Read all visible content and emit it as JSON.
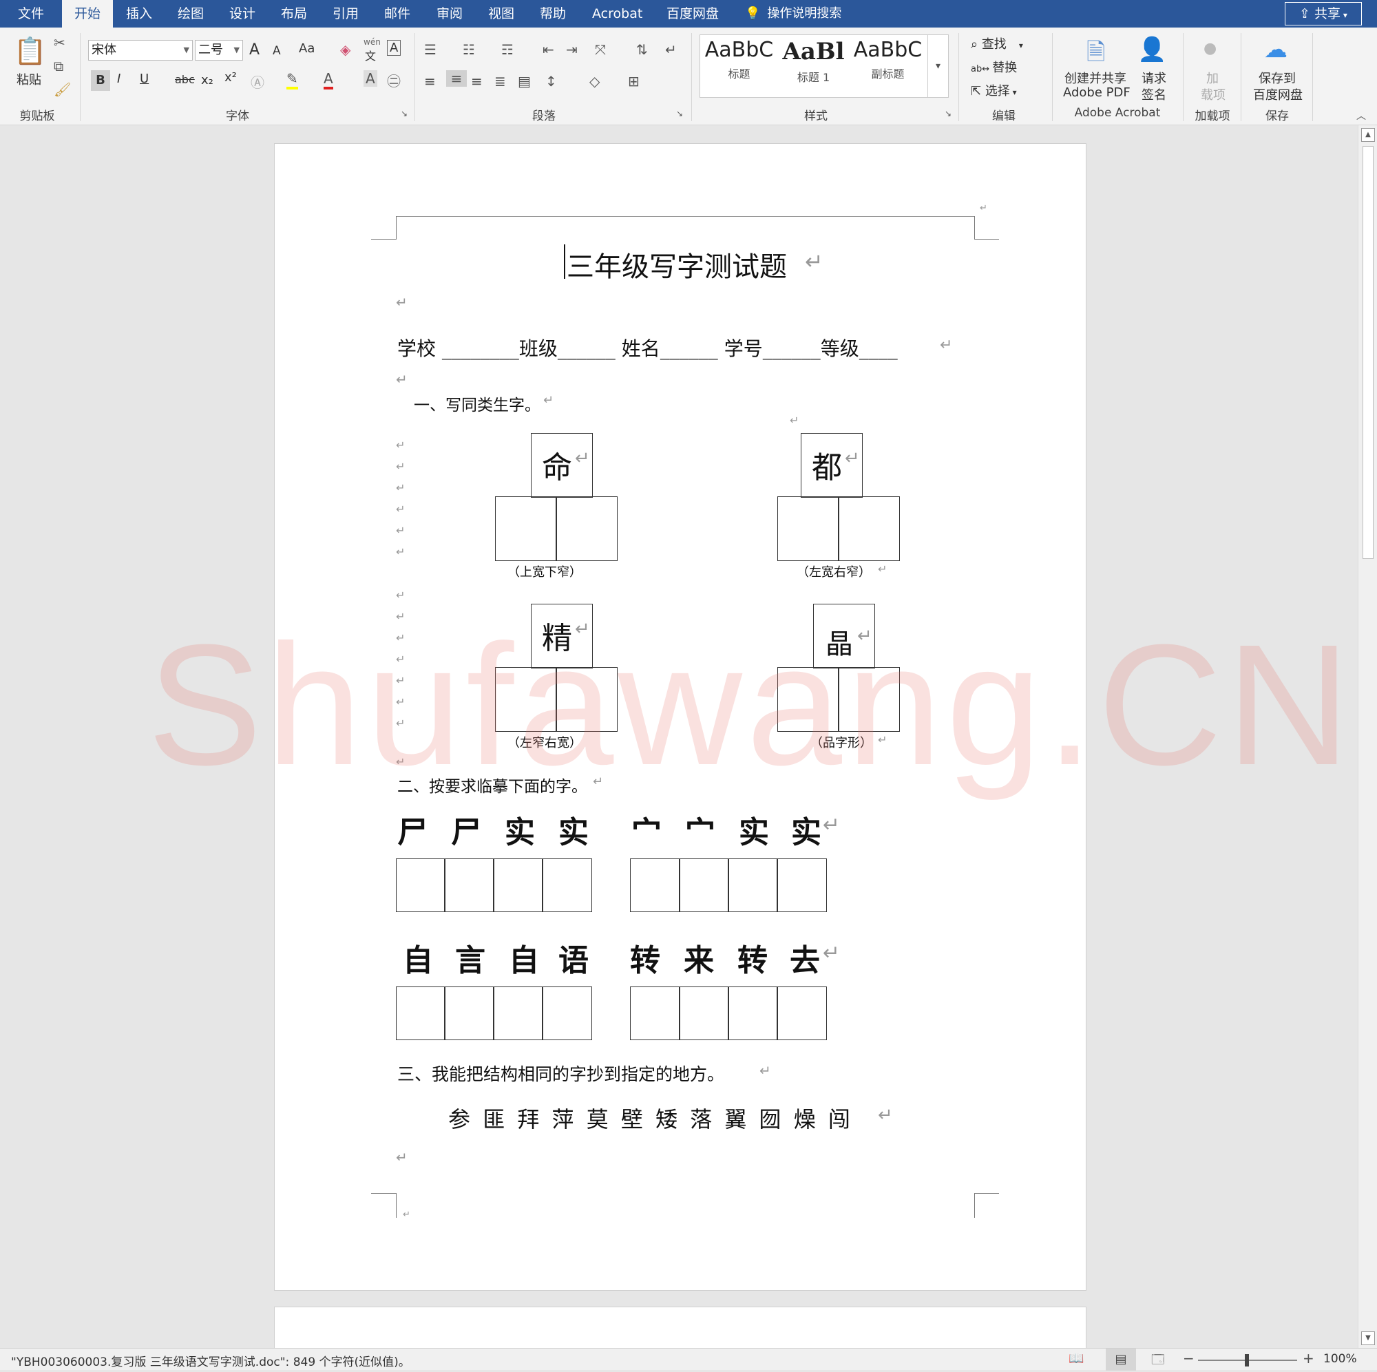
{
  "tabs": [
    "文件",
    "开始",
    "插入",
    "绘图",
    "设计",
    "布局",
    "引用",
    "邮件",
    "审阅",
    "视图",
    "帮助",
    "Acrobat",
    "百度网盘"
  ],
  "active_tab": "开始",
  "tell_me": "操作说明搜索",
  "share": "共享",
  "ribbon": {
    "clipboard": {
      "paste": "粘贴",
      "label": "剪贴板"
    },
    "font": {
      "name": "宋体",
      "size": "二号",
      "case": "Aa",
      "label": "字体",
      "bold": "B",
      "italic": "I",
      "underline": "U",
      "strike": "abc",
      "sub": "x₂",
      "sup": "x²",
      "wen": "wén",
      "wen_char": "文",
      "grow": "A",
      "shrink": "A",
      "charbox": "A"
    },
    "paragraph": {
      "label": "段落"
    },
    "styles": {
      "label": "样式",
      "items": [
        {
          "sample": "AaBbC",
          "name": "标题"
        },
        {
          "sample": "AaBl",
          "name": "标题 1"
        },
        {
          "sample": "AaBbC",
          "name": "副标题"
        }
      ]
    },
    "editing": {
      "find": "查找",
      "replace": "替换",
      "select": "选择",
      "label": "编辑"
    },
    "acrobat": {
      "create_line1": "创建并共享",
      "create_line2": "Adobe PDF",
      "sign_line1": "请求",
      "sign_line2": "签名",
      "label": "Adobe Acrobat"
    },
    "addins": {
      "line1": "加",
      "line2": "载项",
      "label": "加载项"
    },
    "save": {
      "line1": "保存到",
      "line2": "百度网盘",
      "label": "保存"
    }
  },
  "document": {
    "title": "三年级写字测试题",
    "info_line": "学校 ________班级______  姓名______  学号______等级____",
    "section1": "一、写同类生字。",
    "chars": [
      {
        "char": "命",
        "caption": "（上宽下窄）"
      },
      {
        "char": "都",
        "caption": "（左宽右窄）"
      },
      {
        "char": "精",
        "caption": "（左窄右宽）"
      },
      {
        "char": "晶",
        "caption": "（品字形）"
      }
    ],
    "section2": "二、按要求临摹下面的字。",
    "row1": [
      "尸",
      "尸",
      "实",
      "实",
      "宀",
      "宀",
      "实",
      "实"
    ],
    "row2": [
      "自",
      "言",
      "自",
      "语",
      "转",
      "来",
      "转",
      "去"
    ],
    "section3": "三、我能把结构相同的字抄到指定的地方。",
    "char_list": "参 匪 拜 萍 莫 壁 矮 落 翼 囫 燥 闯",
    "return_mark": "↵"
  },
  "watermark": "Shufawang.CN",
  "status": {
    "text": "\"YBH003060003.复习版 三年级语文写字测试.doc\": 849 个字符(近似值)。",
    "zoom": "100%"
  }
}
